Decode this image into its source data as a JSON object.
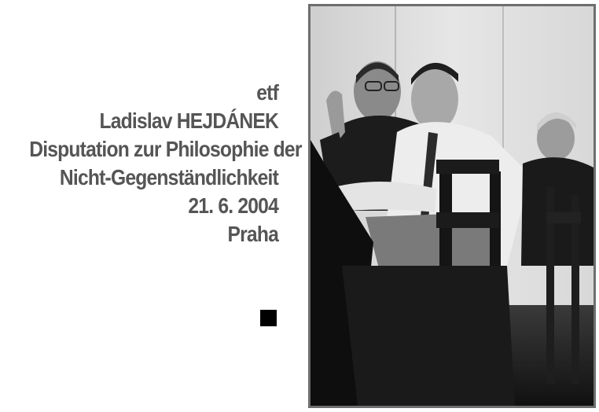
{
  "poster": {
    "lines": [
      "etf",
      "Ladislav HEJDÁNEK",
      "Disputation zur Philosophie der",
      "Nicht-Gegenständlichkeit",
      "21. 6. 2004",
      "Praha"
    ]
  },
  "colors": {
    "text": "#555555",
    "marker": "#000000",
    "frame": "#6e6e6e"
  }
}
